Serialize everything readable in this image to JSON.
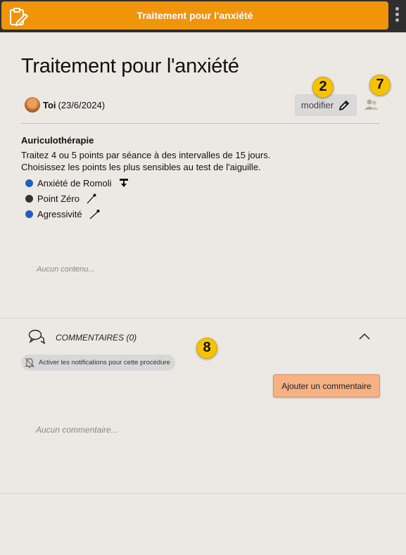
{
  "header": {
    "title": "Traitement pour l'anxiété",
    "app_icon": "clipboard-edit-icon",
    "menu_icon": "vertical-dots-icon",
    "accent_color": "#f0940a"
  },
  "procedure": {
    "title": "Traitement pour l'anxiété",
    "author_name": "Toi",
    "author_date": "(23/6/2024)",
    "edit_label": "modifier",
    "share_icon": "share-users-icon",
    "badges": {
      "edit": "2",
      "share": "7",
      "comments": "8"
    },
    "section_title": "Auriculothérapie",
    "description_line1": "Traitez 4 ou 5 points par séance à des intervalles de 15 jours.",
    "description_line2": "Choisissez les points les plus sensibles au test de l'aiguille.",
    "points": [
      {
        "label": "Anxiété de Romoli",
        "dot_color": "#1f5fc4",
        "icon": "press-pin-icon"
      },
      {
        "label": "Point Zéro",
        "dot_color": "#333333",
        "icon": "needle-icon"
      },
      {
        "label": "Agressivité",
        "dot_color": "#1f5fc4",
        "icon": "needle-icon"
      }
    ],
    "empty_content": "Aucun contenu..."
  },
  "comments": {
    "title": "COMMENTAIRES (0)",
    "notify_label": "Activer les notifications pour cette procédure",
    "add_label": "Ajouter un commentaire",
    "empty_label": "Aucun commentaire..."
  }
}
